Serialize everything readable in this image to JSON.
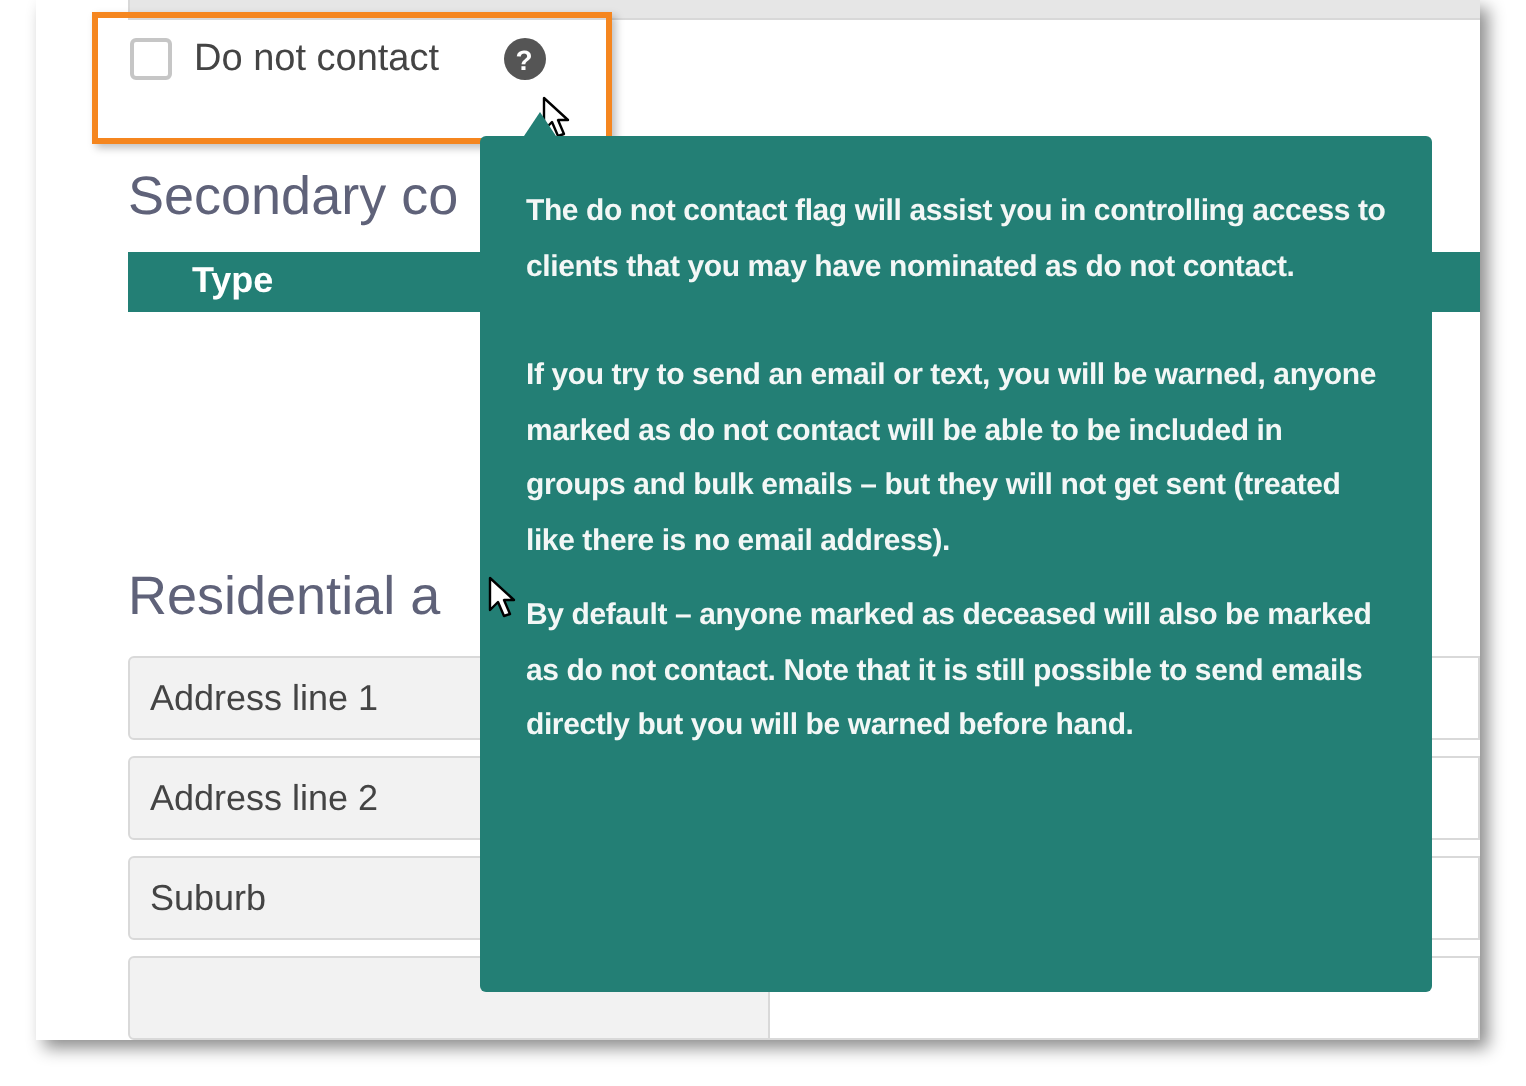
{
  "do_not_contact": {
    "label": "Do not contact",
    "checked": false,
    "highlighted": true,
    "help_icon": "?"
  },
  "secondary_section": {
    "title": "Secondary co",
    "table": {
      "columns": [
        "Type"
      ]
    }
  },
  "residential_section": {
    "title": "Residential a",
    "fields": [
      {
        "label": "Address line 1"
      },
      {
        "label": "Address line 2"
      },
      {
        "label": "Suburb"
      }
    ]
  },
  "tooltip": {
    "paragraphs": [
      "The do not contact flag will assist you in controlling access to clients that you may have nominated as do not contact.",
      "If you try to send an email or text, you will be warned, anyone marked as do not contact will be able to be included in groups and bulk emails – but they will not get sent (treated like there is no email address).",
      "By default – anyone marked as deceased will also be marked as do not contact. Note that it is still possible to send emails directly but you will be warned before hand."
    ]
  }
}
